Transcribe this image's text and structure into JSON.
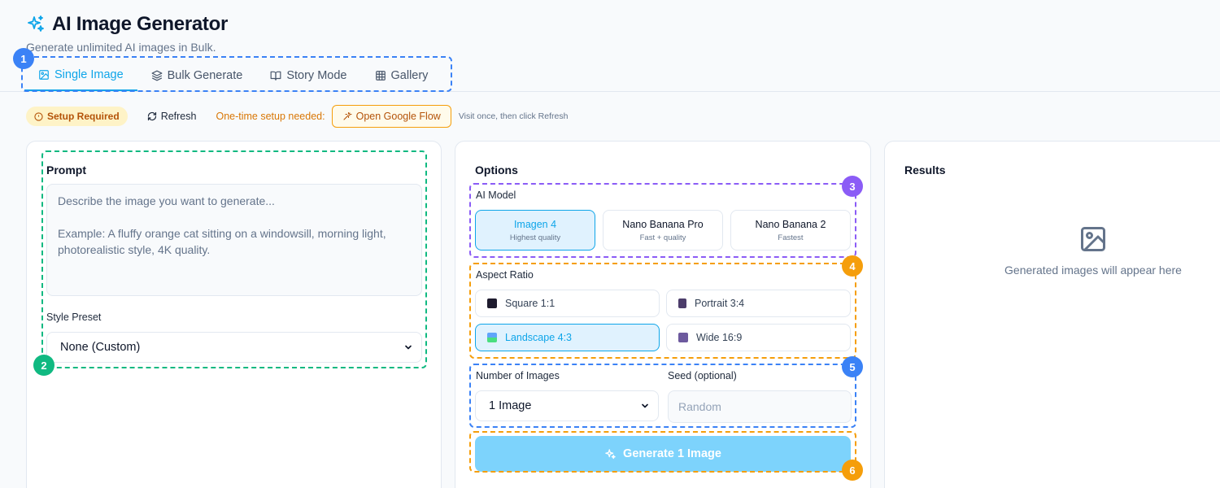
{
  "header": {
    "title": "AI Image Generator",
    "subtitle": "Generate unlimited AI images in Bulk."
  },
  "tabs": [
    {
      "label": "Single Image",
      "icon": "image-icon",
      "active": true
    },
    {
      "label": "Bulk Generate",
      "icon": "layers-icon"
    },
    {
      "label": "Story Mode",
      "icon": "book-icon"
    },
    {
      "label": "Gallery",
      "icon": "grid-icon"
    }
  ],
  "setup": {
    "badge": "Setup Required",
    "refresh_label": "Refresh",
    "note": "One-time setup needed:",
    "open_flow_label": "Open Google Flow",
    "hint": "Visit once, then click Refresh"
  },
  "prompt_panel": {
    "title": "Prompt",
    "placeholder": "Describe the image you want to generate...\n\nExample: A fluffy orange cat sitting on a windowsill, morning light, photorealistic style, 4K quality.",
    "style_label": "Style Preset",
    "style_value": "None (Custom)"
  },
  "options_panel": {
    "title": "Options",
    "model_label": "AI Model",
    "models": [
      {
        "name": "Imagen 4",
        "desc": "Highest quality",
        "active": true
      },
      {
        "name": "Nano Banana Pro",
        "desc": "Fast + quality"
      },
      {
        "name": "Nano Banana 2",
        "desc": "Fastest"
      }
    ],
    "aspect_label": "Aspect Ratio",
    "aspects": [
      {
        "label": "Square 1:1",
        "icon": "square-icon"
      },
      {
        "label": "Portrait 3:4",
        "icon": "portrait-icon"
      },
      {
        "label": "Landscape 4:3",
        "icon": "landscape-icon",
        "active": true
      },
      {
        "label": "Wide 16:9",
        "icon": "clapper-icon"
      }
    ],
    "count_label": "Number of Images",
    "count_value": "1 Image",
    "seed_label": "Seed (optional)",
    "seed_placeholder": "Random",
    "generate_label": "Generate 1 Image"
  },
  "results_panel": {
    "title": "Results",
    "empty_text": "Generated images will appear here"
  },
  "annotations": [
    "1",
    "2",
    "3",
    "4",
    "5",
    "6"
  ],
  "colors": {
    "accent": "#0ea5e9",
    "annot_blue": "#3b82f6",
    "annot_green": "#10b981",
    "annot_purple": "#8b5cf6",
    "annot_orange": "#f59e0b"
  }
}
